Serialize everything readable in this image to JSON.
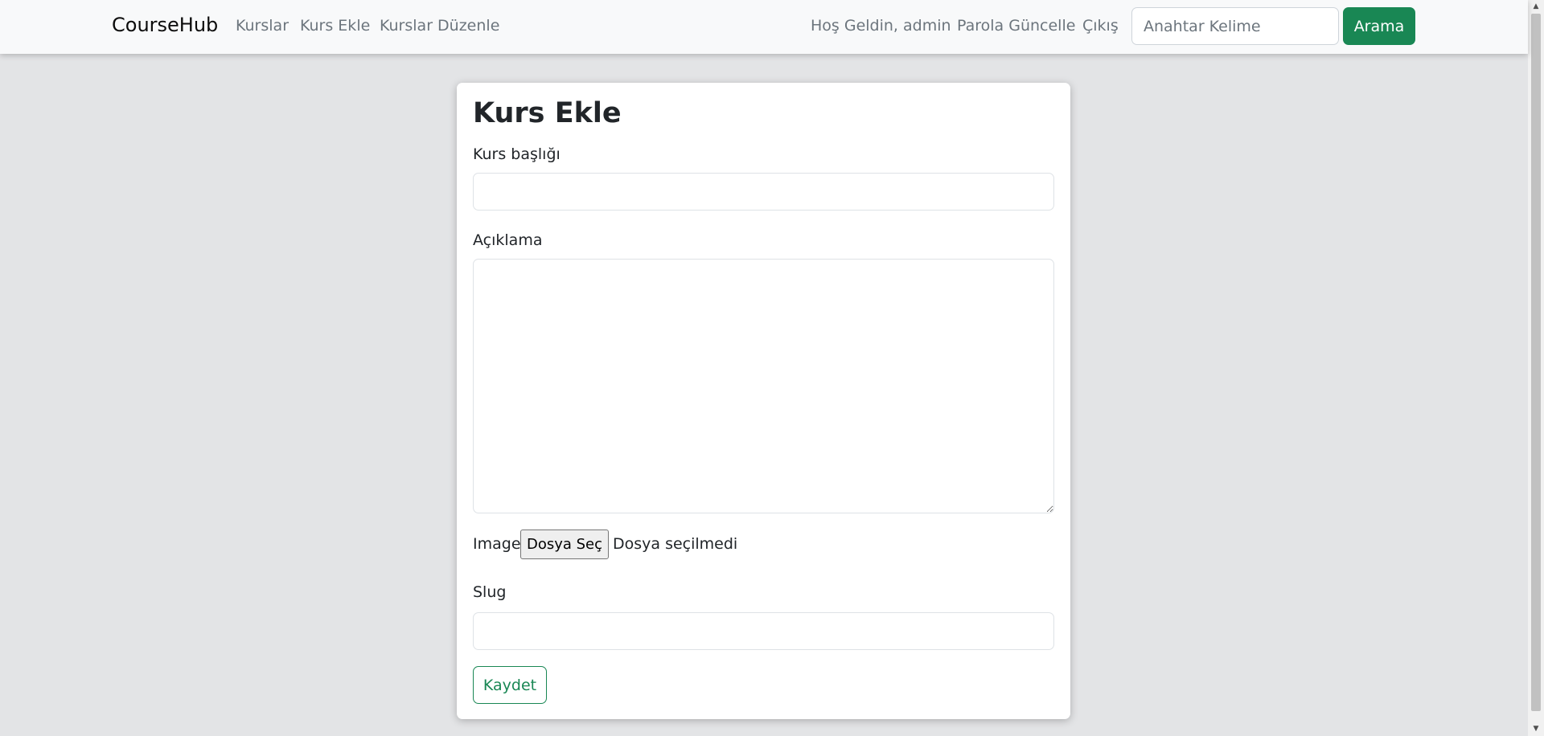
{
  "navbar": {
    "brand": "CourseHub",
    "links": [
      "Kurslar",
      "Kurs Ekle",
      "Kurslar Düzenle"
    ],
    "welcome": "Hoş Geldin, admin",
    "change_password": "Parola Güncelle",
    "logout": "Çıkış",
    "search_placeholder": "Anahtar Kelime",
    "search_button": "Arama"
  },
  "form": {
    "title": "Kurs Ekle",
    "course_title_label": "Kurs başlığı",
    "course_title_value": "",
    "description_label": "Açıklama",
    "description_value": "",
    "image_label": "Image",
    "file_button": "Dosya Seç",
    "file_status": "Dosya seçilmedi",
    "slug_label": "Slug",
    "slug_value": "",
    "save_button": "Kaydet"
  },
  "colors": {
    "accent": "#198754",
    "page_background": "#e3e4e6",
    "navbar_background": "#f8f9fa",
    "nav_link": "#6c757d"
  }
}
